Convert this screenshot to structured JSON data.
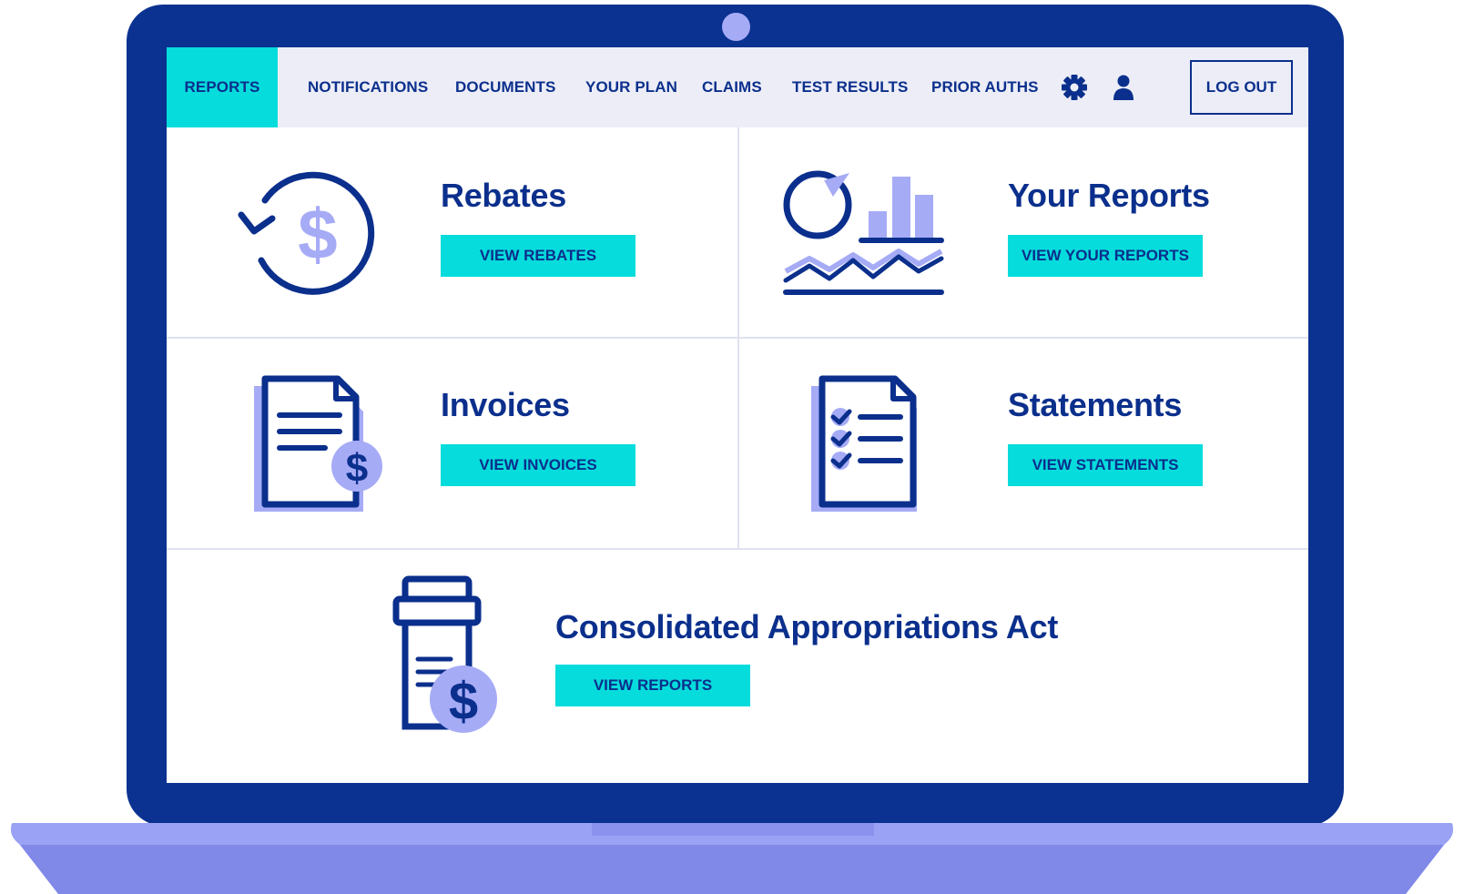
{
  "nav": {
    "items": [
      {
        "label": "REPORTS",
        "active": true
      },
      {
        "label": "NOTIFICATIONS"
      },
      {
        "label": "DOCUMENTS"
      },
      {
        "label": "YOUR PLAN"
      },
      {
        "label": "CLAIMS"
      },
      {
        "label": "TEST RESULTS"
      },
      {
        "label": "PRIOR AUTHS"
      }
    ],
    "settings_icon": "gear-icon",
    "profile_icon": "user-icon",
    "logout_label": "LOG OUT"
  },
  "cards": [
    {
      "title": "Rebates",
      "button": "VIEW REBATES",
      "icon": "refund-dollar-icon"
    },
    {
      "title": "Your Reports",
      "button": "VIEW YOUR REPORTS",
      "icon": "charts-icon"
    },
    {
      "title": "Invoices",
      "button": "VIEW INVOICES",
      "icon": "invoice-document-icon"
    },
    {
      "title": "Statements",
      "button": "VIEW STATEMENTS",
      "icon": "checklist-document-icon"
    },
    {
      "title": "Consolidated Appropriations Act",
      "button": "VIEW REPORTS",
      "icon": "prescription-bottle-dollar-icon"
    }
  ],
  "colors": {
    "navy": "#0b2f8c",
    "frame": "#0b3290",
    "accent": "#06dcdc",
    "lavender": "#a6abf6",
    "nav_bg": "#ecedf7"
  }
}
